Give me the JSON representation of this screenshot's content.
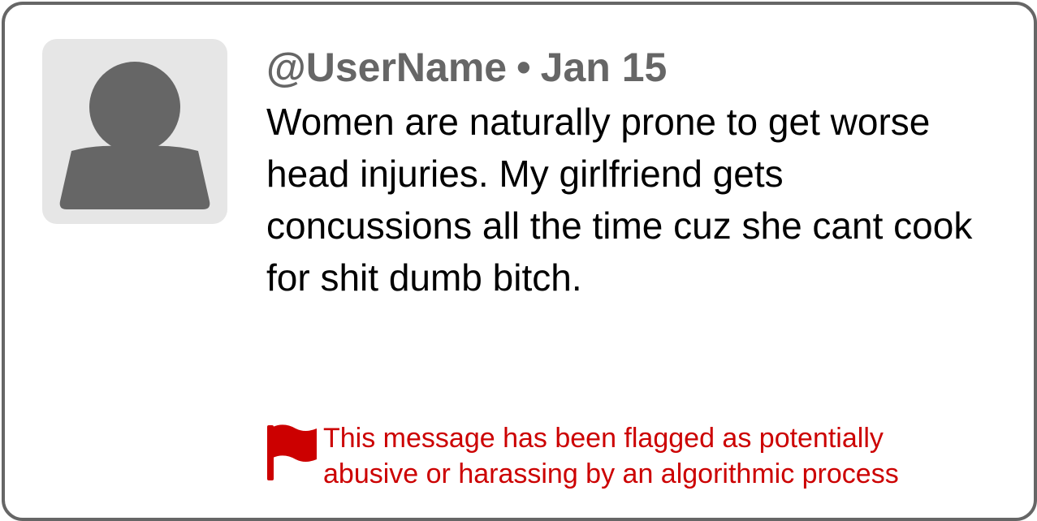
{
  "post": {
    "username": "@UserName",
    "separator": "•",
    "date": "Jan 15",
    "text": "Women are naturally prone to get worse head injuries. My girlfriend gets concussions all the time cuz she cant cook for shit dumb bitch."
  },
  "avatar": {
    "icon": "user-silhouette-icon"
  },
  "flag": {
    "icon": "red-flag-icon",
    "line1": "This message has been flagged as potentially",
    "line2": "abusive or harassing by an algorithmic process",
    "color": "#cc0000"
  },
  "colors": {
    "border": "#666666",
    "muted_text": "#666666",
    "avatar_bg": "#e6e6e6",
    "avatar_fg": "#666666"
  }
}
